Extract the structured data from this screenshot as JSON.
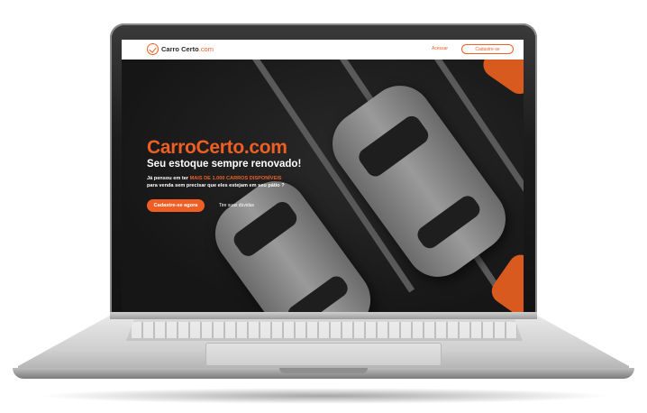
{
  "header": {
    "logo_name": "Carro Certo",
    "logo_domain": ".com",
    "nav_link": "Acessar",
    "nav_button": "Cadastre-se"
  },
  "hero": {
    "title": "CarroCerto.com",
    "subtitle": "Seu estoque sempre renovado!",
    "desc_prefix": "Já pensou em ter ",
    "desc_highlight": "MAIS DE 1.000 CARROS DISPONÍVEIS",
    "desc_suffix": "para venda sem precisar que eles estejam em seu pátio ?",
    "cta_label": "Cadastre-se agora",
    "secondary_link": "Tire suas dúvidas"
  },
  "colors": {
    "accent": "#ef5f24",
    "hero_bg": "#1a1a1a",
    "header_bg": "#ffffff"
  },
  "icons": {
    "logo": "car-check-icon"
  }
}
